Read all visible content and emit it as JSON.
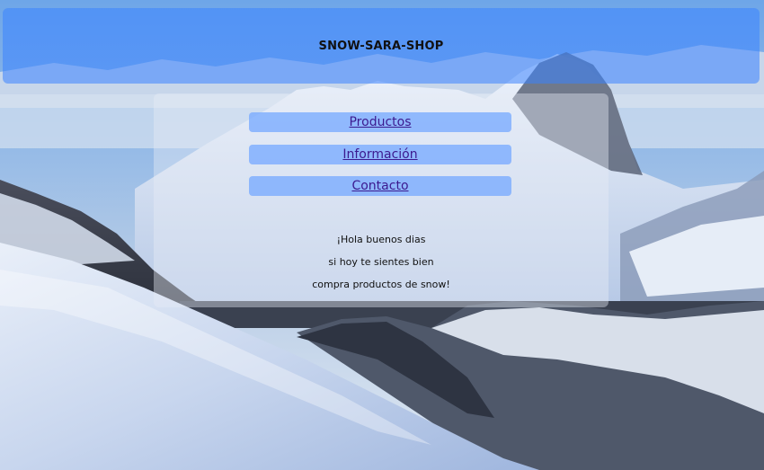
{
  "header": {
    "title": "SNOW-SARA-SHOP"
  },
  "nav": {
    "items": [
      {
        "label": "Productos"
      },
      {
        "label": "Información"
      },
      {
        "label": "Contacto"
      }
    ]
  },
  "message": {
    "lines": [
      "¡Hola buenos dias",
      "si hoy te sientes bien",
      "compra productos de snow!"
    ]
  },
  "colors": {
    "header_bg": "#3a84ff",
    "nav_bg": "#78aaff",
    "link_text": "#3c1a8f"
  }
}
